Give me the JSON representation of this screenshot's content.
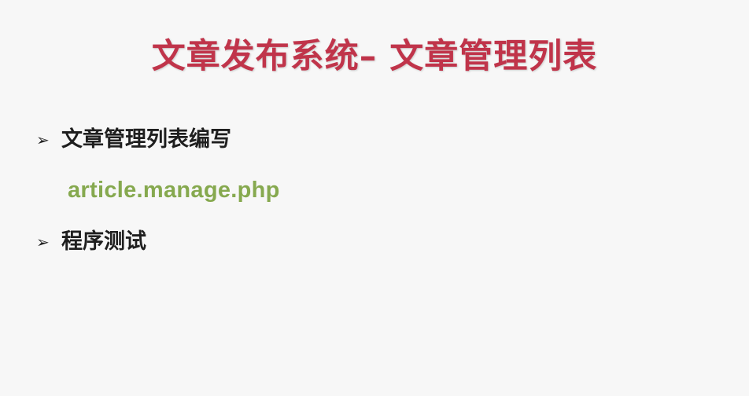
{
  "slide": {
    "title": "文章发布系统– 文章管理列表",
    "bullets": [
      {
        "arrow": "➢",
        "text": "文章管理列表编写"
      },
      {
        "arrow": "➢",
        "text": "程序测试"
      }
    ],
    "subitem": "article.manage.php"
  },
  "colors": {
    "title": "#c0344a",
    "bullet_text": "#1f1f1f",
    "subitem": "#86a94f",
    "background": "#f7f7f7"
  }
}
